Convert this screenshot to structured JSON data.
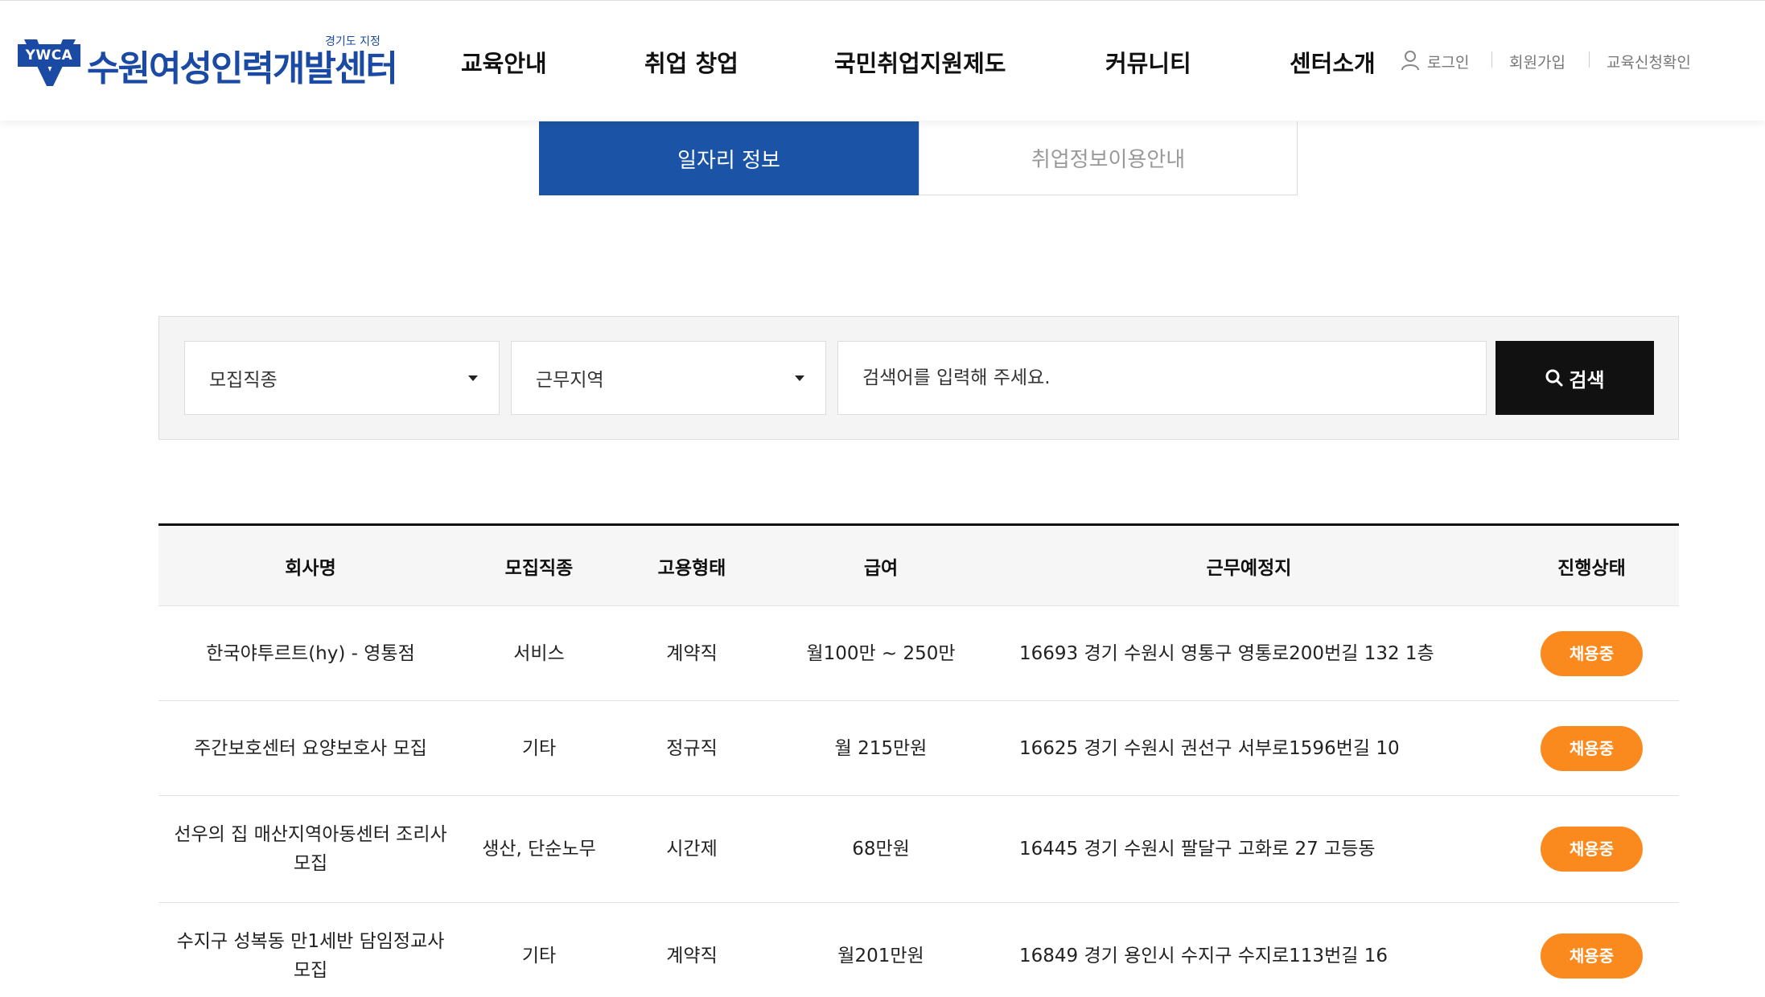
{
  "header": {
    "logo_badge": "YWCA",
    "logo_sub": "경기도 지정",
    "logo_name": "수원여성인력개발센터",
    "nav": [
      "교육안내",
      "취업 창업",
      "국민취업지원제도",
      "커뮤니티",
      "센터소개"
    ],
    "util": {
      "login": "로그인",
      "join": "회원가입",
      "check": "교육신청확인"
    }
  },
  "tabs": {
    "active": "일자리 정보",
    "inactive": "취업정보이용안내"
  },
  "search": {
    "job_type": "모집직종",
    "region": "근무지역",
    "placeholder": "검색어를 입력해 주세요.",
    "button": "검색"
  },
  "table": {
    "headers": [
      "회사명",
      "모집직종",
      "고용형태",
      "급여",
      "근무예정지",
      "진행상태"
    ],
    "rows": [
      {
        "company": "한국야투르트(hy) - 영통점",
        "job": "서비스",
        "type": "계약직",
        "salary": "월100만 ~ 250만",
        "address": "16693 경기 수원시 영통구 영통로200번길 132 1층",
        "status": "채용중"
      },
      {
        "company": "주간보호센터 요양보호사 모집",
        "job": "기타",
        "type": "정규직",
        "salary": "월 215만원",
        "address": "16625 경기 수원시 권선구 서부로1596번길 10",
        "status": "채용중"
      },
      {
        "company": "선우의 집 매산지역아동센터 조리사 모집",
        "job": "생산, 단순노무",
        "type": "시간제",
        "salary": "68만원",
        "address": "16445 경기 수원시 팔달구 고화로 27 고등동",
        "status": "채용중"
      },
      {
        "company": "수지구 성복동 만1세반 담임정교사 모집",
        "job": "기타",
        "type": "계약직",
        "salary": "월201만원",
        "address": "16849 경기 용인시 수지구 수지로113번길 16",
        "status": "채용중"
      }
    ]
  },
  "colors": {
    "brand": "#1b54a6",
    "status": "#fb8a1e",
    "search_button": "#111111"
  }
}
